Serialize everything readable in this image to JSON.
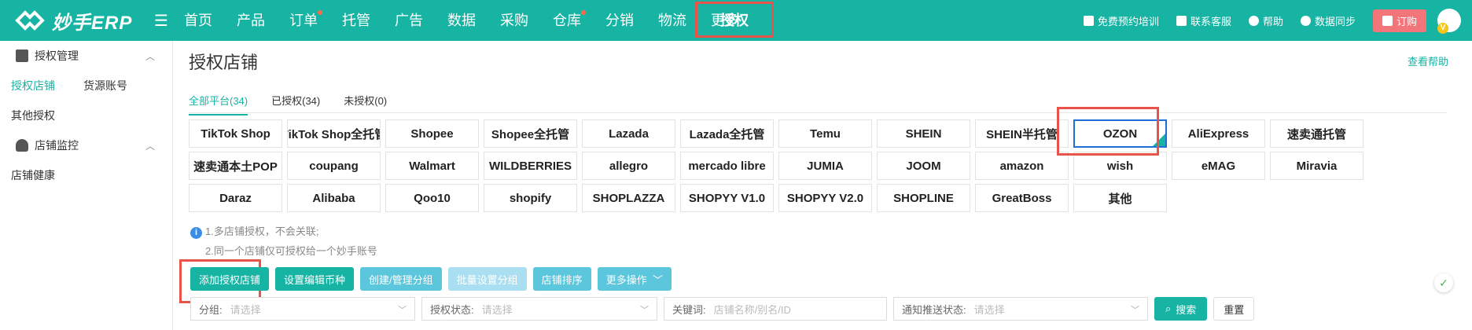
{
  "brand": {
    "name": "妙手ERP"
  },
  "nav": {
    "items": [
      "首页",
      "产品",
      "订单",
      "托管",
      "广告",
      "数据",
      "采购",
      "仓库",
      "分销",
      "物流",
      "更多"
    ],
    "active": "授权"
  },
  "top_right": {
    "training": "免费预约培训",
    "contact": "联系客服",
    "help": "帮助",
    "sync": "数据同步",
    "order": "订购"
  },
  "sidebar": {
    "group1": "授权管理",
    "group1_items": [
      "授权店铺",
      "货源账号",
      "其他授权"
    ],
    "group2": "店铺监控",
    "group2_items": [
      "店铺健康"
    ]
  },
  "main": {
    "title": "授权店铺",
    "help_link": "查看帮助",
    "tabs": [
      "全部平台(34)",
      "已授权(34)",
      "未授权(0)"
    ],
    "platforms": [
      "TikTok Shop",
      "TikTok Shop全托管",
      "Shopee",
      "Shopee全托管",
      "Lazada",
      "Lazada全托管",
      "Temu",
      "SHEIN",
      "SHEIN半托管",
      "OZON",
      "AliExpress",
      "速卖通托管",
      "速卖通本土POP",
      "coupang",
      "Walmart",
      "WILDBERRIES",
      "allegro",
      "mercado libre",
      "JUMIA",
      "JOOM",
      "amazon",
      "wish",
      "eMAG",
      "Miravia",
      "Daraz",
      "Alibaba",
      "Qoo10",
      "shopify",
      "SHOPLAZZA",
      "SHOPYY V1.0",
      "SHOPYY V2.0",
      "SHOPLINE",
      "GreatBoss",
      "其他"
    ],
    "note1": "1.多店铺授权，不会关联;",
    "note2": "2.同一个店铺仅可授权给一个妙手账号",
    "buttons": [
      "添加授权店铺",
      "设置编辑币种",
      "创建/管理分组",
      "批量设置分组",
      "店铺排序",
      "更多操作"
    ],
    "filters": {
      "group_label": "分组:",
      "group_ph": "请选择",
      "auth_label": "授权状态:",
      "auth_ph": "请选择",
      "kw_label": "关键词:",
      "kw_ph": "店铺名称/别名/ID",
      "notify_label": "通知推送状态:",
      "notify_ph": "请选择",
      "search": "搜索",
      "reset": "重置"
    }
  }
}
